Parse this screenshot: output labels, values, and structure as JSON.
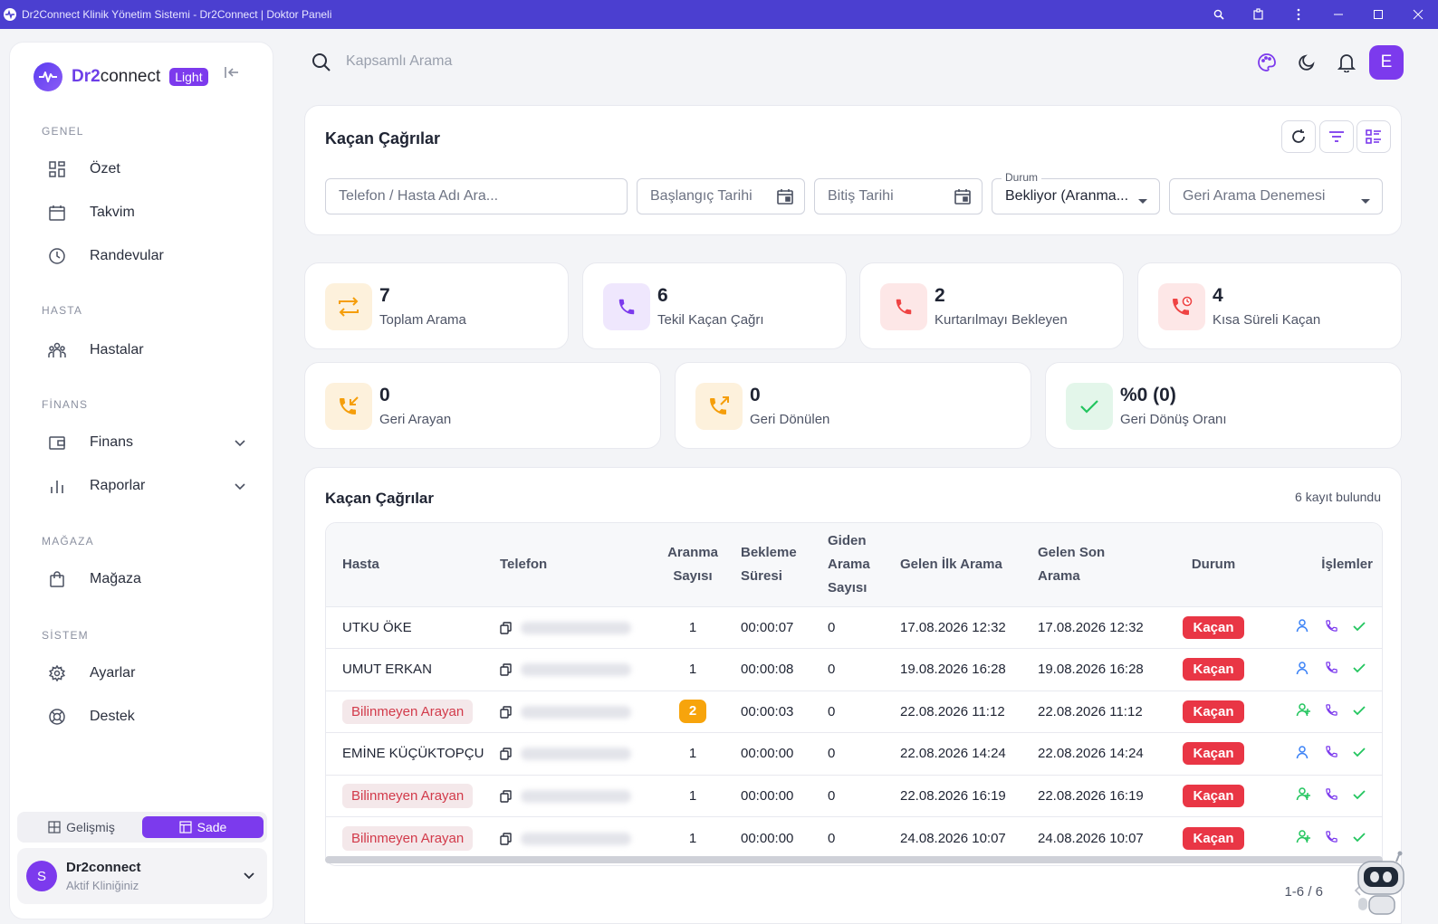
{
  "window": {
    "title": "Dr2Connect Klinik Yönetim Sistemi - Dr2Connect | Doktor Paneli"
  },
  "brand": {
    "name_bold": "Dr2",
    "name_rest": "connect",
    "badge": "Light"
  },
  "sidebar": {
    "sections": {
      "genel": "GENEL",
      "hasta": "HASTA",
      "finans": "FİNANS",
      "magaza": "MAĞAZA",
      "sistem": "SİSTEM"
    },
    "items": {
      "ozet": "Özet",
      "takvim": "Takvim",
      "randevular": "Randevular",
      "hastalar": "Hastalar",
      "finans": "Finans",
      "raporlar": "Raporlar",
      "magaza": "Mağaza",
      "ayarlar": "Ayarlar",
      "destek": "Destek"
    },
    "mode": {
      "advanced": "Gelişmiş",
      "simple": "Sade"
    },
    "clinic": {
      "avatar": "S",
      "name": "Dr2connect",
      "subtitle": "Aktif Kliniğiniz"
    }
  },
  "header": {
    "search_placeholder": "Kapsamlı Arama",
    "user_initial": "E"
  },
  "filters": {
    "title": "Kaçan Çağrılar",
    "search_placeholder": "Telefon / Hasta Adı Ara...",
    "start_date": "Başlangıç Tarihi",
    "end_date": "Bitiş Tarihi",
    "status_label": "Durum",
    "status_value": "Bekliyor (Aranma...",
    "retry_placeholder": "Geri Arama Denemesi"
  },
  "stats": [
    {
      "value": "7",
      "label": "Toplam Arama",
      "color": "#f59e0b"
    },
    {
      "value": "6",
      "label": "Tekil Kaçan Çağrı",
      "color": "#7c3aed"
    },
    {
      "value": "2",
      "label": "Kurtarılmayı Bekleyen",
      "color": "#ef4444"
    },
    {
      "value": "4",
      "label": "Kısa Süreli Kaçan",
      "color": "#ef4444"
    },
    {
      "value": "0",
      "label": "Geri Arayan",
      "color": "#f59e0b"
    },
    {
      "value": "0",
      "label": "Geri Dönülen",
      "color": "#f59e0b"
    },
    {
      "value": "%0 (0)",
      "label": "Geri Dönüş Oranı",
      "color": "#22c55e"
    }
  ],
  "table": {
    "title": "Kaçan Çağrılar",
    "count_text": "6 kayıt bulundu",
    "headers": {
      "hasta": "Hasta",
      "telefon": "Telefon",
      "aranma_1": "Aranma",
      "aranma_2": "Sayısı",
      "bekleme_1": "Bekleme",
      "bekleme_2": "Süresi",
      "giden_1": "Giden",
      "giden_2": "Arama",
      "giden_3": "Sayısı",
      "ilk": "Gelen İlk Arama",
      "son_1": "Gelen Son",
      "son_2": "Arama",
      "durum": "Durum",
      "islemler": "İşlemler"
    },
    "rows": [
      {
        "patient": "UTKU ÖKE",
        "unknown": false,
        "calls": "1",
        "wait": "00:00:07",
        "outgoing": "0",
        "first": "17.08.2026 12:32",
        "last": "17.08.2026 12:32",
        "status": "Kaçan"
      },
      {
        "patient": "UMUT ERKAN",
        "unknown": false,
        "calls": "1",
        "wait": "00:00:08",
        "outgoing": "0",
        "first": "19.08.2026 16:28",
        "last": "19.08.2026 16:28",
        "status": "Kaçan"
      },
      {
        "patient": "Bilinmeyen Arayan",
        "unknown": true,
        "calls": "2",
        "wait": "00:00:03",
        "outgoing": "0",
        "first": "22.08.2026 11:12",
        "last": "22.08.2026 11:12",
        "status": "Kaçan"
      },
      {
        "patient": "EMİNE KÜÇÜKTOPÇU",
        "unknown": false,
        "calls": "1",
        "wait": "00:00:00",
        "outgoing": "0",
        "first": "22.08.2026 14:24",
        "last": "22.08.2026 14:24",
        "status": "Kaçan"
      },
      {
        "patient": "Bilinmeyen Arayan",
        "unknown": true,
        "calls": "1",
        "wait": "00:00:00",
        "outgoing": "0",
        "first": "22.08.2026 16:19",
        "last": "22.08.2026 16:19",
        "status": "Kaçan"
      },
      {
        "patient": "Bilinmeyen Arayan",
        "unknown": true,
        "calls": "1",
        "wait": "00:00:00",
        "outgoing": "0",
        "first": "24.08.2026 10:07",
        "last": "24.08.2026 10:07",
        "status": "Kaçan"
      }
    ],
    "pagination": "1-6 / 6"
  }
}
